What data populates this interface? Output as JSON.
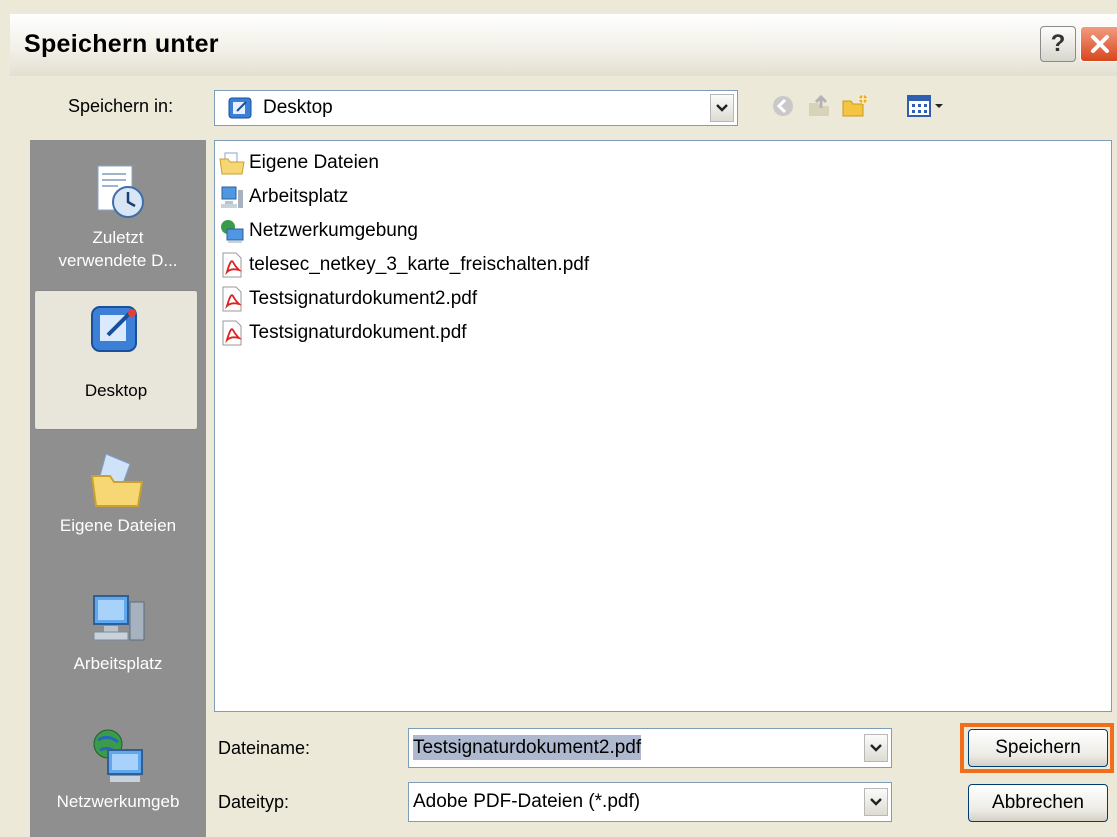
{
  "window": {
    "title": "Speichern unter",
    "help_label": "?"
  },
  "location": {
    "label": "Speichern in:",
    "value": "Desktop"
  },
  "places": [
    {
      "label": "Zuletzt\nverwendete D...",
      "line1": "Zuletzt",
      "line2": "verwendete D..."
    },
    {
      "label": "Desktop"
    },
    {
      "label": "Eigene Dateien"
    },
    {
      "label": "Arbeitsplatz"
    },
    {
      "label": "Netzwerkumgeb"
    }
  ],
  "files": [
    {
      "name": "Eigene Dateien",
      "icon": "folder-icon"
    },
    {
      "name": "Arbeitsplatz",
      "icon": "computer-icon"
    },
    {
      "name": "Netzwerkumgebung",
      "icon": "network-icon"
    },
    {
      "name": "telesec_netkey_3_karte_freischalten.pdf",
      "icon": "pdf-icon"
    },
    {
      "name": "Testsignaturdokument2.pdf",
      "icon": "pdf-icon"
    },
    {
      "name": "Testsignaturdokument.pdf",
      "icon": "pdf-icon"
    }
  ],
  "filename": {
    "label": "Dateiname:",
    "value": "Testsignaturdokument2.pdf"
  },
  "filetype": {
    "label": "Dateityp:",
    "value": "Adobe PDF-Dateien (*.pdf)"
  },
  "buttons": {
    "save": "Speichern",
    "cancel": "Abbrechen"
  },
  "colors": {
    "highlight": "#f06e1c",
    "selection": "#316ac5",
    "places_bg": "#8f8f8f"
  }
}
